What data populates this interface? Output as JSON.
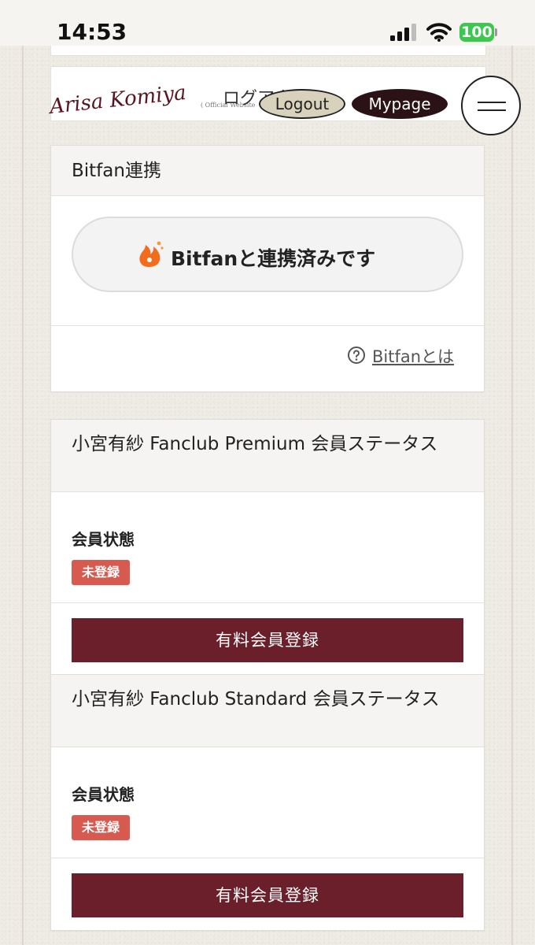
{
  "status_bar": {
    "time": "14:53",
    "battery": "100"
  },
  "header": {
    "logo_text": "Arisa Komiya",
    "logo_subtitle": "( Official Website",
    "logout_overlay_text": "ログアウト",
    "logout_label": "Logout",
    "mypage_label": "Mypage"
  },
  "bitfan_card": {
    "title": "Bitfan連携",
    "button_label": "Bitfanと連携済みです",
    "help_link": "Bitfanとは"
  },
  "premium_card": {
    "title": "小宮有紗 Fanclub Premium 会員ステータス",
    "status_label": "会員状態",
    "status_badge": "未登録",
    "register_label": "有料会員登録"
  },
  "standard_card": {
    "title": "小宮有紗 Fanclub Standard 会員ステータス",
    "status_label": "会員状態",
    "status_badge": "未登録",
    "register_label": "有料会員登録"
  },
  "colors": {
    "accent": "#6a1f2a",
    "badge": "#d65a50",
    "battery": "#3cc74e",
    "mypage": "#2b1216",
    "logout": "#d8d2bd"
  }
}
